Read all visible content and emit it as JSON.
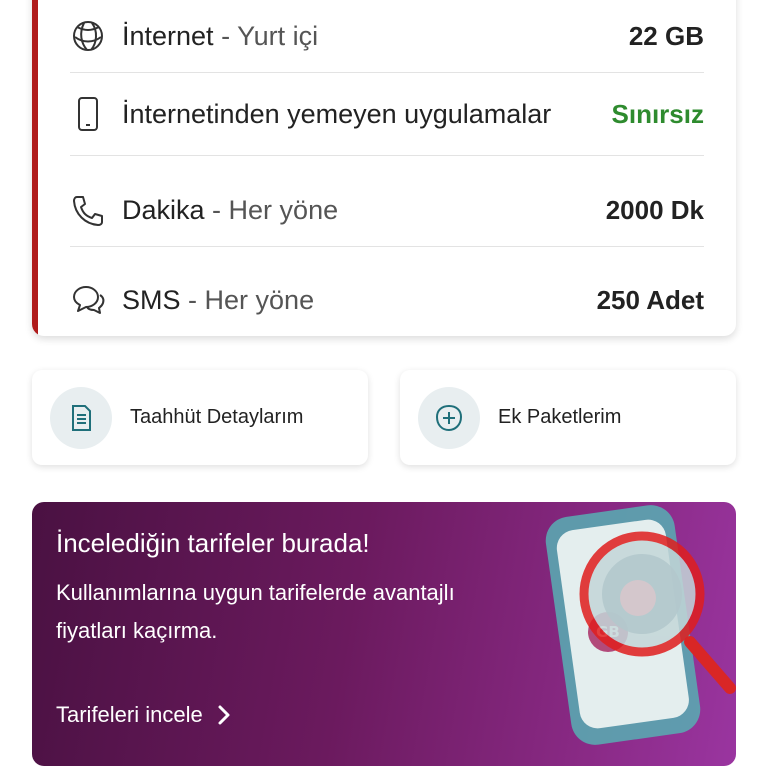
{
  "usage": {
    "rows": [
      {
        "icon": "globe-icon",
        "label": "İnternet",
        "sub": "- Yurt içi",
        "value": "22 GB"
      },
      {
        "icon": "phone-device-icon",
        "label": "İnternetinden yemeyen uygulamalar",
        "sub": "",
        "value": "Sınırsız"
      },
      {
        "icon": "phone-call-icon",
        "label": "Dakika",
        "sub": "- Her yöne",
        "value": "2000 Dk"
      },
      {
        "icon": "chat-bubbles-icon",
        "label": "SMS",
        "sub": "- Her yöne",
        "value": "250 Adet"
      }
    ]
  },
  "quick_actions": [
    {
      "icon": "document-icon",
      "label": "Taahhüt Detaylarım"
    },
    {
      "icon": "add-circle-icon",
      "label": "Ek Paketlerim"
    }
  ],
  "promo": {
    "title": "İncelediğin tarifeler burada!",
    "description": "Kullanımlarına uygun tarifelerde avantajlı fiyatları kaçırma.",
    "cta": "Tarifeleri incele",
    "badge": "GB"
  },
  "colors": {
    "accent_red": "#b01c1c",
    "unlimited_green": "#2e8b2e",
    "promo_purple": "#6b1a5e"
  }
}
